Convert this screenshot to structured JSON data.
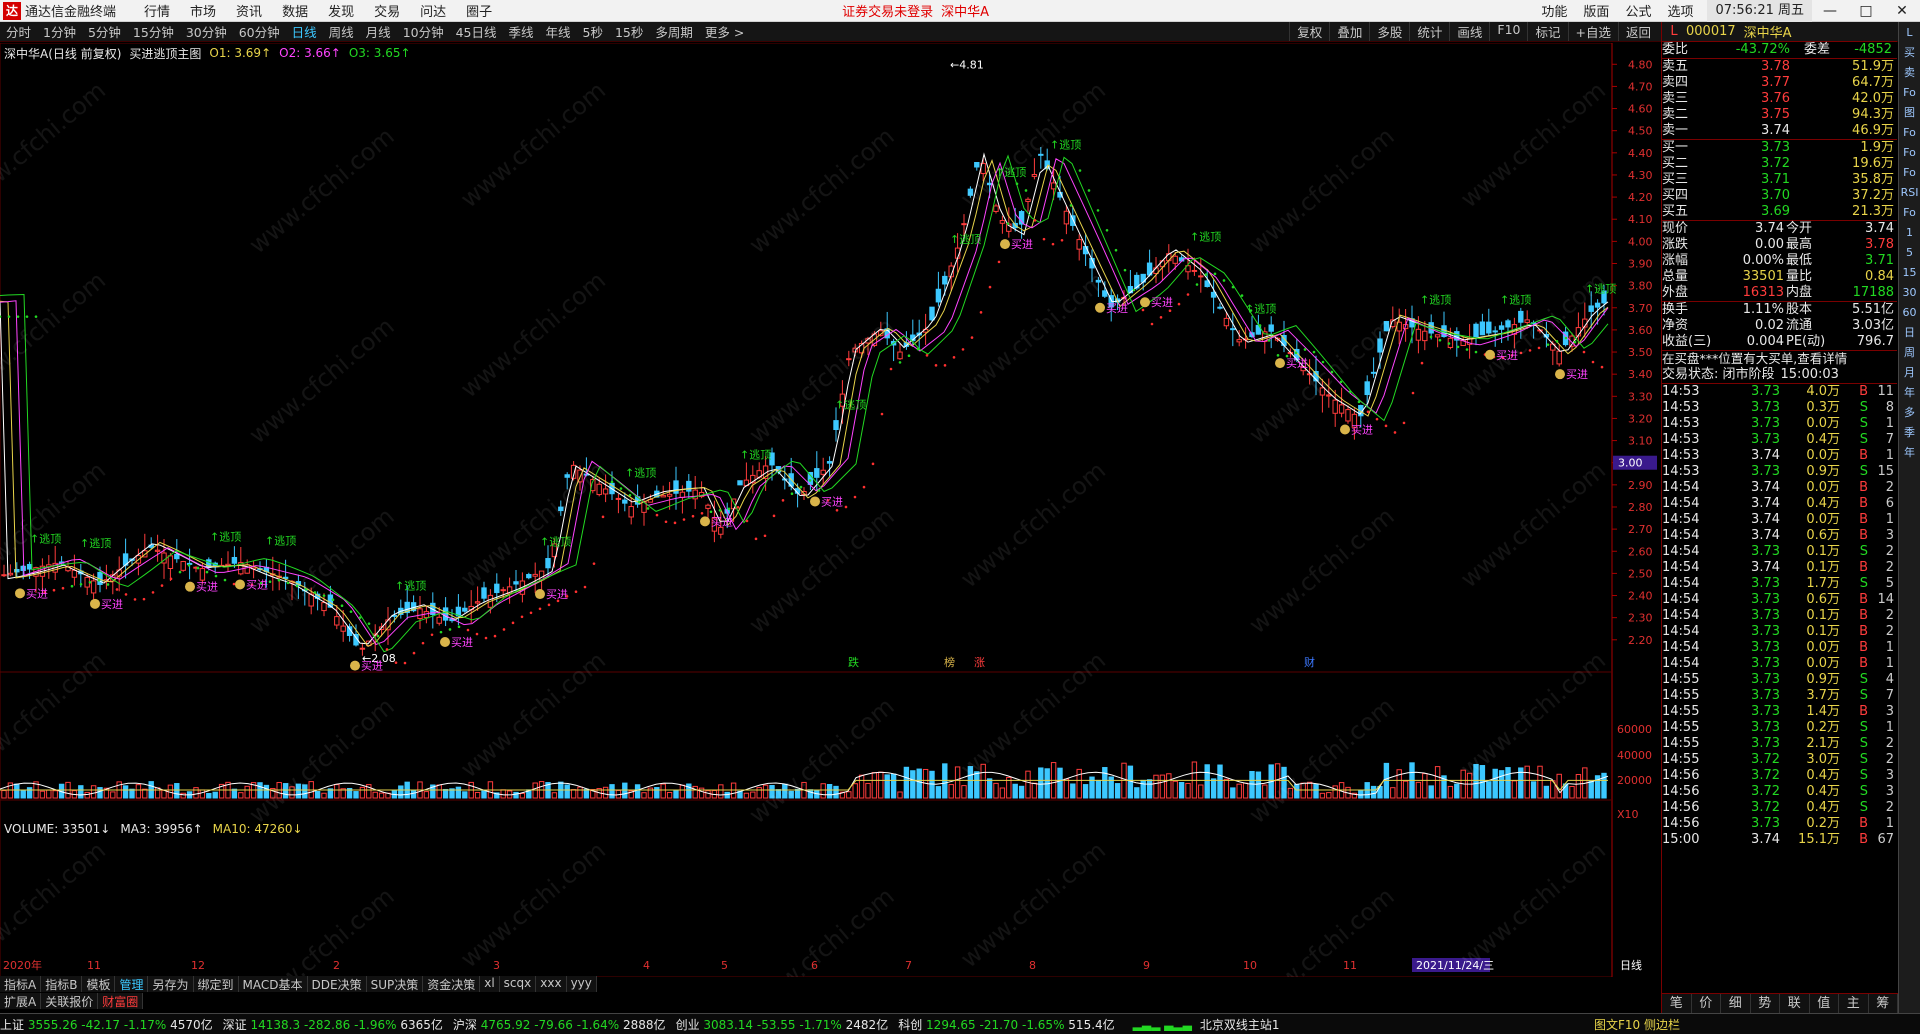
{
  "titlebar": {
    "app_name": "通达信金融终端",
    "menu": [
      "行情",
      "市场",
      "资讯",
      "数据",
      "发现",
      "交易",
      "问达",
      "圈子"
    ],
    "notice": "证券交易未登录",
    "notice_stock": "深中华A",
    "tools": [
      "功能",
      "版面",
      "公式",
      "选项"
    ],
    "clock": "07:56:21 周五"
  },
  "periods": [
    "分时",
    "1分钟",
    "5分钟",
    "15分钟",
    "30分钟",
    "60分钟",
    "日线",
    "周线",
    "月线",
    "10分钟",
    "45日线",
    "季线",
    "年线",
    "5秒",
    "15秒",
    "多周期",
    "更多 >"
  ],
  "active_period": "日线",
  "right_tools": [
    "复权",
    "叠加",
    "多股",
    "统计",
    "画线",
    "F10",
    "标记",
    "+自选",
    "返回"
  ],
  "chart_info": {
    "name": "深中华A(日线 前复权)",
    "formula": "买进逃顶主图",
    "o1": "O1: 3.69↑",
    "o2": "O2: 3.66↑",
    "o3": "O3: 3.65↑"
  },
  "volume_info": {
    "vol": "VOLUME: 33501↓",
    "ma3": "MA3: 39956↑",
    "ma10": "MA10: 47260↓"
  },
  "price_axis": [
    "4.80",
    "4.70",
    "4.60",
    "4.50",
    "4.40",
    "4.30",
    "4.20",
    "4.10",
    "4.00",
    "3.90",
    "3.80",
    "3.70",
    "3.60",
    "3.50",
    "3.40",
    "3.30",
    "3.20",
    "3.10",
    "3.00",
    "2.90",
    "2.80",
    "2.70",
    "2.60",
    "2.50",
    "2.40",
    "2.30",
    "2.20"
  ],
  "highlight_price": "3.00",
  "vol_axis": [
    "60000",
    "40000",
    "20000",
    "X10"
  ],
  "x_labels": [
    "2020年",
    "11",
    "12",
    "2",
    "3",
    "4",
    "5",
    "6",
    "7",
    "8",
    "9",
    "10",
    "11"
  ],
  "date_cursor": "2021/11/24/三",
  "annotations": {
    "high": "4.81",
    "low": "2.08",
    "buy": "买进",
    "top": "逃顶",
    "event1": "跌",
    "event2": "榜",
    "event3": "涨",
    "event4": "财"
  },
  "x_axis_unit": "日线",
  "indicator_tabs": [
    "指标A",
    "指标B",
    "模板",
    "管理",
    "另存为",
    "绑定到",
    "MACD基本",
    "DDE决策",
    "SUP决策",
    "资金决策",
    "xl",
    "scqx",
    "xxx",
    "yyy"
  ],
  "sub_tabs": [
    "扩展A",
    "关联报价",
    "财富圈"
  ],
  "status": {
    "indices": [
      {
        "name": "上证",
        "value": "3555.26",
        "chg": "-42.17",
        "pct": "-1.17%",
        "amt": "4570亿"
      },
      {
        "name": "深证",
        "value": "14138.3",
        "chg": "-282.86",
        "pct": "-1.96%",
        "amt": "6365亿"
      },
      {
        "name": "沪深",
        "value": "4765.92",
        "chg": "-79.66",
        "pct": "-1.64%",
        "amt": "2888亿"
      },
      {
        "name": "创业",
        "value": "3083.14",
        "chg": "-53.55",
        "pct": "-1.71%",
        "amt": "2482亿"
      },
      {
        "name": "科创",
        "value": "1294.65",
        "chg": "-21.70",
        "pct": "-1.65%",
        "amt": "515.4亿"
      }
    ],
    "server": "北京双线主站1",
    "extra": "图文F10 侧边栏"
  },
  "panel": {
    "code": "000017",
    "name": "深中华A",
    "weibi_label": "委比",
    "weibi": "-43.72%",
    "weicha_label": "委差",
    "weicha": "-4852",
    "asks": [
      {
        "label": "卖五",
        "price": "3.78",
        "vol": "51.9万"
      },
      {
        "label": "卖四",
        "price": "3.77",
        "vol": "64.7万"
      },
      {
        "label": "卖三",
        "price": "3.76",
        "vol": "42.0万"
      },
      {
        "label": "卖二",
        "price": "3.75",
        "vol": "94.3万"
      },
      {
        "label": "卖一",
        "price": "3.74",
        "vol": "46.9万"
      }
    ],
    "bids": [
      {
        "label": "买一",
        "price": "3.73",
        "vol": "1.9万"
      },
      {
        "label": "买二",
        "price": "3.72",
        "vol": "19.6万"
      },
      {
        "label": "买三",
        "price": "3.71",
        "vol": "35.8万"
      },
      {
        "label": "买四",
        "price": "3.70",
        "vol": "37.2万"
      },
      {
        "label": "买五",
        "price": "3.69",
        "vol": "21.3万"
      }
    ],
    "stats": [
      {
        "l1": "现价",
        "v1": "3.74",
        "l2": "今开",
        "v2": "3.74"
      },
      {
        "l1": "涨跌",
        "v1": "0.00",
        "l2": "最高",
        "v2": "3.78"
      },
      {
        "l1": "涨幅",
        "v1": "0.00%",
        "l2": "最低",
        "v2": "3.71"
      },
      {
        "l1": "总量",
        "v1": "33501",
        "l2": "量比",
        "v2": "0.84"
      },
      {
        "l1": "外盘",
        "v1": "16313",
        "l2": "内盘",
        "v2": "17188"
      },
      {
        "l1": "换手",
        "v1": "1.11%",
        "l2": "股本",
        "v2": "5.51亿"
      },
      {
        "l1": "净资",
        "v1": "0.02",
        "l2": "流通",
        "v2": "3.03亿"
      },
      {
        "l1": "收益(三)",
        "v1": "0.004",
        "l2": "PE(动)",
        "v2": "796.7"
      }
    ],
    "notice": "在买盘***位置有大买单,查看详情",
    "trade_state": "交易状态: 闭市阶段",
    "trade_time": "15:00:03",
    "ticks": [
      [
        "14:53",
        "3.73",
        "4.0万",
        "B",
        "11"
      ],
      [
        "14:53",
        "3.73",
        "0.3万",
        "S",
        "8"
      ],
      [
        "14:53",
        "3.73",
        "0.0万",
        "S",
        "1"
      ],
      [
        "14:53",
        "3.73",
        "0.4万",
        "S",
        "7"
      ],
      [
        "14:53",
        "3.74",
        "0.0万",
        "B",
        "1"
      ],
      [
        "14:53",
        "3.73",
        "0.9万",
        "S",
        "15"
      ],
      [
        "14:54",
        "3.74",
        "0.0万",
        "B",
        "2"
      ],
      [
        "14:54",
        "3.74",
        "0.4万",
        "B",
        "6"
      ],
      [
        "14:54",
        "3.74",
        "0.0万",
        "B",
        "1"
      ],
      [
        "14:54",
        "3.74",
        "0.6万",
        "B",
        "3"
      ],
      [
        "14:54",
        "3.73",
        "0.1万",
        "S",
        "2"
      ],
      [
        "14:54",
        "3.74",
        "0.1万",
        "B",
        "2"
      ],
      [
        "14:54",
        "3.73",
        "1.7万",
        "S",
        "5"
      ],
      [
        "14:54",
        "3.73",
        "0.6万",
        "B",
        "14"
      ],
      [
        "14:54",
        "3.73",
        "0.1万",
        "B",
        "2"
      ],
      [
        "14:54",
        "3.73",
        "0.1万",
        "B",
        "2"
      ],
      [
        "14:54",
        "3.73",
        "0.0万",
        "B",
        "1"
      ],
      [
        "14:54",
        "3.73",
        "0.0万",
        "B",
        "1"
      ],
      [
        "14:55",
        "3.73",
        "0.9万",
        "S",
        "4"
      ],
      [
        "14:55",
        "3.73",
        "3.7万",
        "S",
        "7"
      ],
      [
        "14:55",
        "3.73",
        "1.4万",
        "B",
        "3"
      ],
      [
        "14:55",
        "3.73",
        "0.2万",
        "S",
        "1"
      ],
      [
        "14:55",
        "3.73",
        "2.1万",
        "S",
        "2"
      ],
      [
        "14:55",
        "3.72",
        "3.0万",
        "S",
        "2"
      ],
      [
        "14:56",
        "3.72",
        "0.4万",
        "S",
        "3"
      ],
      [
        "14:56",
        "3.72",
        "0.4万",
        "S",
        "3"
      ],
      [
        "14:56",
        "3.72",
        "0.4万",
        "S",
        "2"
      ],
      [
        "14:56",
        "3.73",
        "0.2万",
        "B",
        "1"
      ],
      [
        "15:00",
        "3.74",
        "15.1万",
        "B",
        "67"
      ]
    ],
    "tabs": [
      "笔",
      "价",
      "细",
      "势",
      "联",
      "值",
      "主",
      "筹"
    ]
  },
  "sidebar_items": [
    "L",
    "买",
    "卖",
    "Fo",
    "图",
    "Fo",
    "Fo",
    "Fo",
    "RSI",
    "Fo",
    "1",
    "5",
    "15",
    "30",
    "60",
    "日",
    "周",
    "月",
    "年",
    "多",
    "季",
    "年"
  ],
  "watermark": "www.cfchi.com",
  "colors": {
    "up": "#ff3c3c",
    "down": "#3cc8ff",
    "ma1": "#ffffff",
    "ma2": "#e8d44a",
    "ma3": "#ff44ff",
    "ma4": "#22d822",
    "dot_up": "#ff3030",
    "dot_down": "#22d822"
  }
}
